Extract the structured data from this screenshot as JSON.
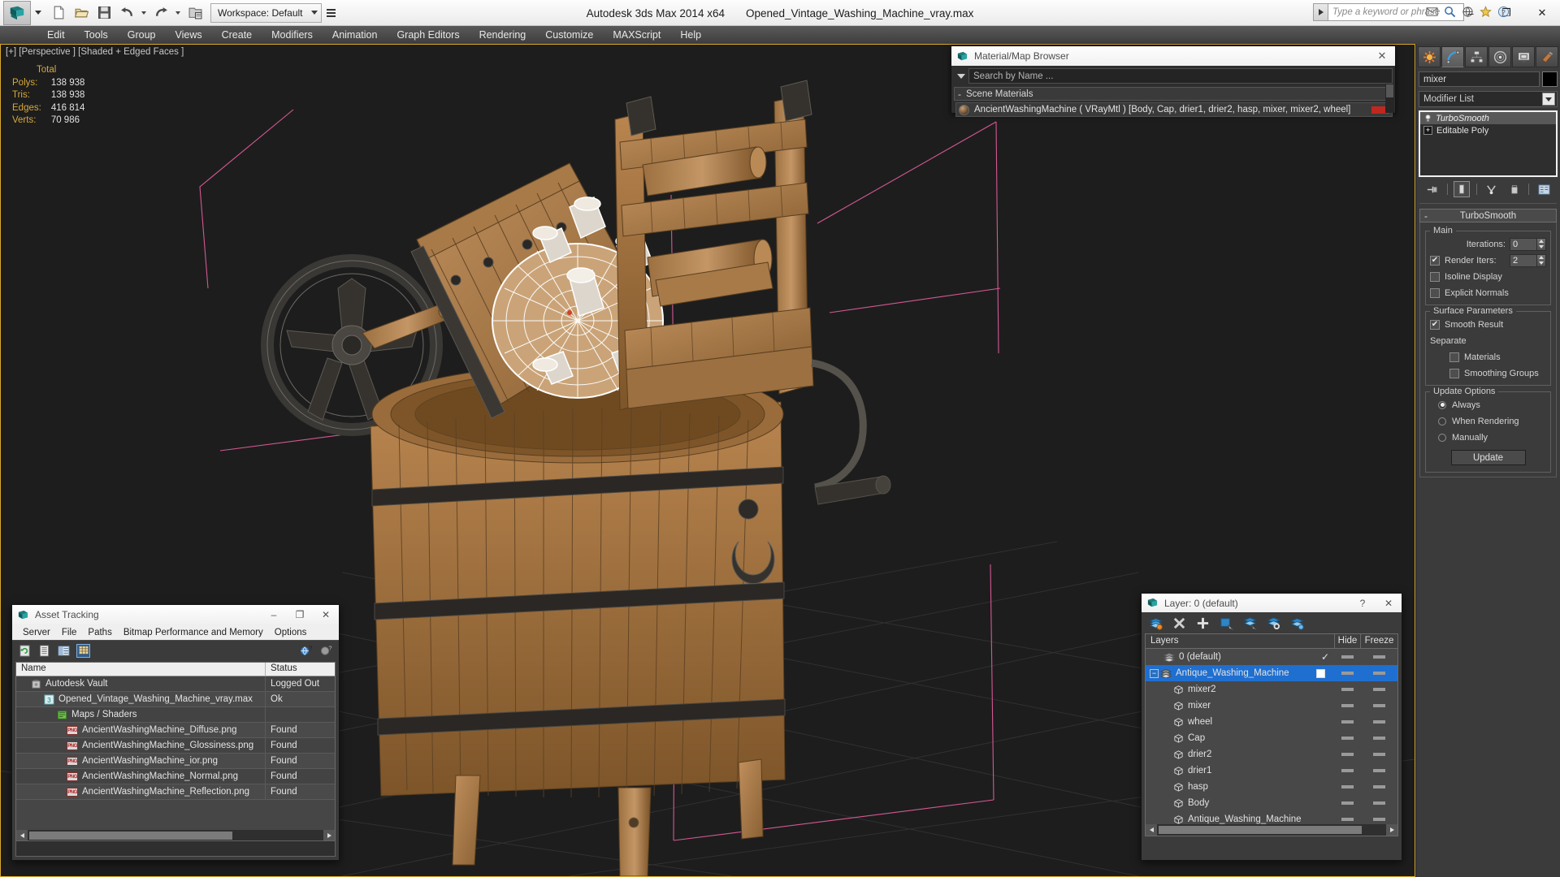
{
  "titlebar": {
    "app_title": "Autodesk 3ds Max  2014 x64",
    "file_title": "Opened_Vintage_Washing_Machine_vray.max",
    "workspace_label": "Workspace: Default",
    "search_placeholder": "Type a keyword or phrase",
    "window_buttons": {
      "minimize": "–",
      "maximize": "❐",
      "close": "✕"
    },
    "quick_access": [
      "new-icon",
      "open-icon",
      "save-icon",
      "undo-icon",
      "redo-icon",
      "set-project-icon"
    ]
  },
  "menubar": {
    "items": [
      "Edit",
      "Tools",
      "Group",
      "Views",
      "Create",
      "Modifiers",
      "Animation",
      "Graph Editors",
      "Rendering",
      "Customize",
      "MAXScript",
      "Help"
    ]
  },
  "viewport": {
    "label": "[+] [Perspective ] [Shaded + Edged Faces ]",
    "stats_header": "Total",
    "stats": [
      {
        "label": "Polys:",
        "value": "138 938"
      },
      {
        "label": "Tris:",
        "value": "138 938"
      },
      {
        "label": "Edges:",
        "value": "416 814"
      },
      {
        "label": "Verts:",
        "value": "70 986"
      }
    ]
  },
  "material_browser": {
    "title": "Material/Map Browser",
    "close_label": "✕",
    "search_placeholder": "Search by Name ...",
    "group_minus": "-",
    "group_label": "Scene Materials",
    "material_row": "AncientWashingMachine  ( VRayMtl )  [Body, Cap, drier1, drier2, hasp, mixer, mixer2, wheel]"
  },
  "command_panel": {
    "tabs": [
      "create-tab-icon",
      "modify-tab-icon",
      "hierarchy-tab-icon",
      "motion-tab-icon",
      "display-tab-icon",
      "utilities-tab-icon"
    ],
    "active_tab_index": 1,
    "object_name": "mixer",
    "object_color": "#000000",
    "modifier_list_label": "Modifier List",
    "stack": [
      {
        "label": "TurboSmooth",
        "selected": true,
        "italic": true
      },
      {
        "label": "Editable Poly",
        "selected": false,
        "italic": false
      }
    ],
    "rollout": {
      "title": "TurboSmooth",
      "minus": "-",
      "sections": [
        {
          "legend": "Main",
          "iterations_label": "Iterations:",
          "iterations_value": "0",
          "render_iters_label": "Render Iters:",
          "render_iters_value": "2",
          "render_iters_checked": true,
          "isoline_label": "Isoline Display",
          "isoline_checked": false,
          "explicit_label": "Explicit Normals",
          "explicit_checked": false
        },
        {
          "legend": "Surface Parameters",
          "smooth_label": "Smooth Result",
          "smooth_checked": true,
          "separate_label": "Separate",
          "materials_label": "Materials",
          "materials_checked": false,
          "smoothing_groups_label": "Smoothing Groups",
          "smoothing_groups_checked": false
        },
        {
          "legend": "Update Options",
          "options": [
            {
              "label": "Always",
              "selected": true
            },
            {
              "label": "When Rendering",
              "selected": false
            },
            {
              "label": "Manually",
              "selected": false
            }
          ],
          "update_button": "Update"
        }
      ]
    }
  },
  "asset_tracking": {
    "title": "Asset Tracking",
    "window_buttons": {
      "minimize": "–",
      "maximize": "❐",
      "close": "✕"
    },
    "menu": [
      "Server",
      "File",
      "Paths",
      "Bitmap Performance and Memory",
      "Options"
    ],
    "columns": [
      "Name",
      "Status"
    ],
    "rows": [
      {
        "name": "Autodesk Vault",
        "status": "Logged Out",
        "indent": 1,
        "icon": "vault-icon"
      },
      {
        "name": "Opened_Vintage_Washing_Machine_vray.max",
        "status": "Ok",
        "indent": 2,
        "icon": "max-file-icon"
      },
      {
        "name": "Maps / Shaders",
        "status": "",
        "indent": 3,
        "icon": "maps-icon"
      },
      {
        "name": "AncientWashingMachine_Diffuse.png",
        "status": "Found",
        "indent": 4,
        "icon": "png-icon"
      },
      {
        "name": "AncientWashingMachine_Glossiness.png",
        "status": "Found",
        "indent": 4,
        "icon": "png-icon"
      },
      {
        "name": "AncientWashingMachine_ior.png",
        "status": "Found",
        "indent": 4,
        "icon": "png-icon"
      },
      {
        "name": "AncientWashingMachine_Normal.png",
        "status": "Found",
        "indent": 4,
        "icon": "png-icon"
      },
      {
        "name": "AncientWashingMachine_Reflection.png",
        "status": "Found",
        "indent": 4,
        "icon": "png-icon"
      }
    ]
  },
  "layer_dialog": {
    "title": "Layer: 0 (default)",
    "help_label": "?",
    "close_label": "✕",
    "columns": {
      "layers": "Layers",
      "hide": "Hide",
      "freeze": "Freeze"
    },
    "rows": [
      {
        "name": "0 (default)",
        "indent": 1,
        "selected": false,
        "check": "✓",
        "kind": "layer"
      },
      {
        "name": "Antique_Washing_Machine",
        "indent": 0,
        "selected": true,
        "check": "",
        "kind": "layer",
        "expander": "−",
        "box": true
      },
      {
        "name": "mixer2",
        "indent": 2,
        "selected": false,
        "check": "",
        "kind": "object"
      },
      {
        "name": "mixer",
        "indent": 2,
        "selected": false,
        "check": "",
        "kind": "object"
      },
      {
        "name": "wheel",
        "indent": 2,
        "selected": false,
        "check": "",
        "kind": "object"
      },
      {
        "name": "Cap",
        "indent": 2,
        "selected": false,
        "check": "",
        "kind": "object"
      },
      {
        "name": "drier2",
        "indent": 2,
        "selected": false,
        "check": "",
        "kind": "object"
      },
      {
        "name": "drier1",
        "indent": 2,
        "selected": false,
        "check": "",
        "kind": "object"
      },
      {
        "name": "hasp",
        "indent": 2,
        "selected": false,
        "check": "",
        "kind": "object"
      },
      {
        "name": "Body",
        "indent": 2,
        "selected": false,
        "check": "",
        "kind": "object"
      },
      {
        "name": "Antique_Washing_Machine",
        "indent": 2,
        "selected": false,
        "check": "",
        "kind": "object"
      }
    ]
  },
  "colors": {
    "viewport_border": "#d9a82f",
    "stats_text": "#d7a93b",
    "selection_blue": "#1f6fd0",
    "material_flag": "#c0281f",
    "wood_light": "#c59362",
    "wood_dark": "#8a5f33",
    "metal_dark": "#2f2c28",
    "highlight_white": "#ffffff",
    "gizmo_pink": "#ef5fa0"
  }
}
